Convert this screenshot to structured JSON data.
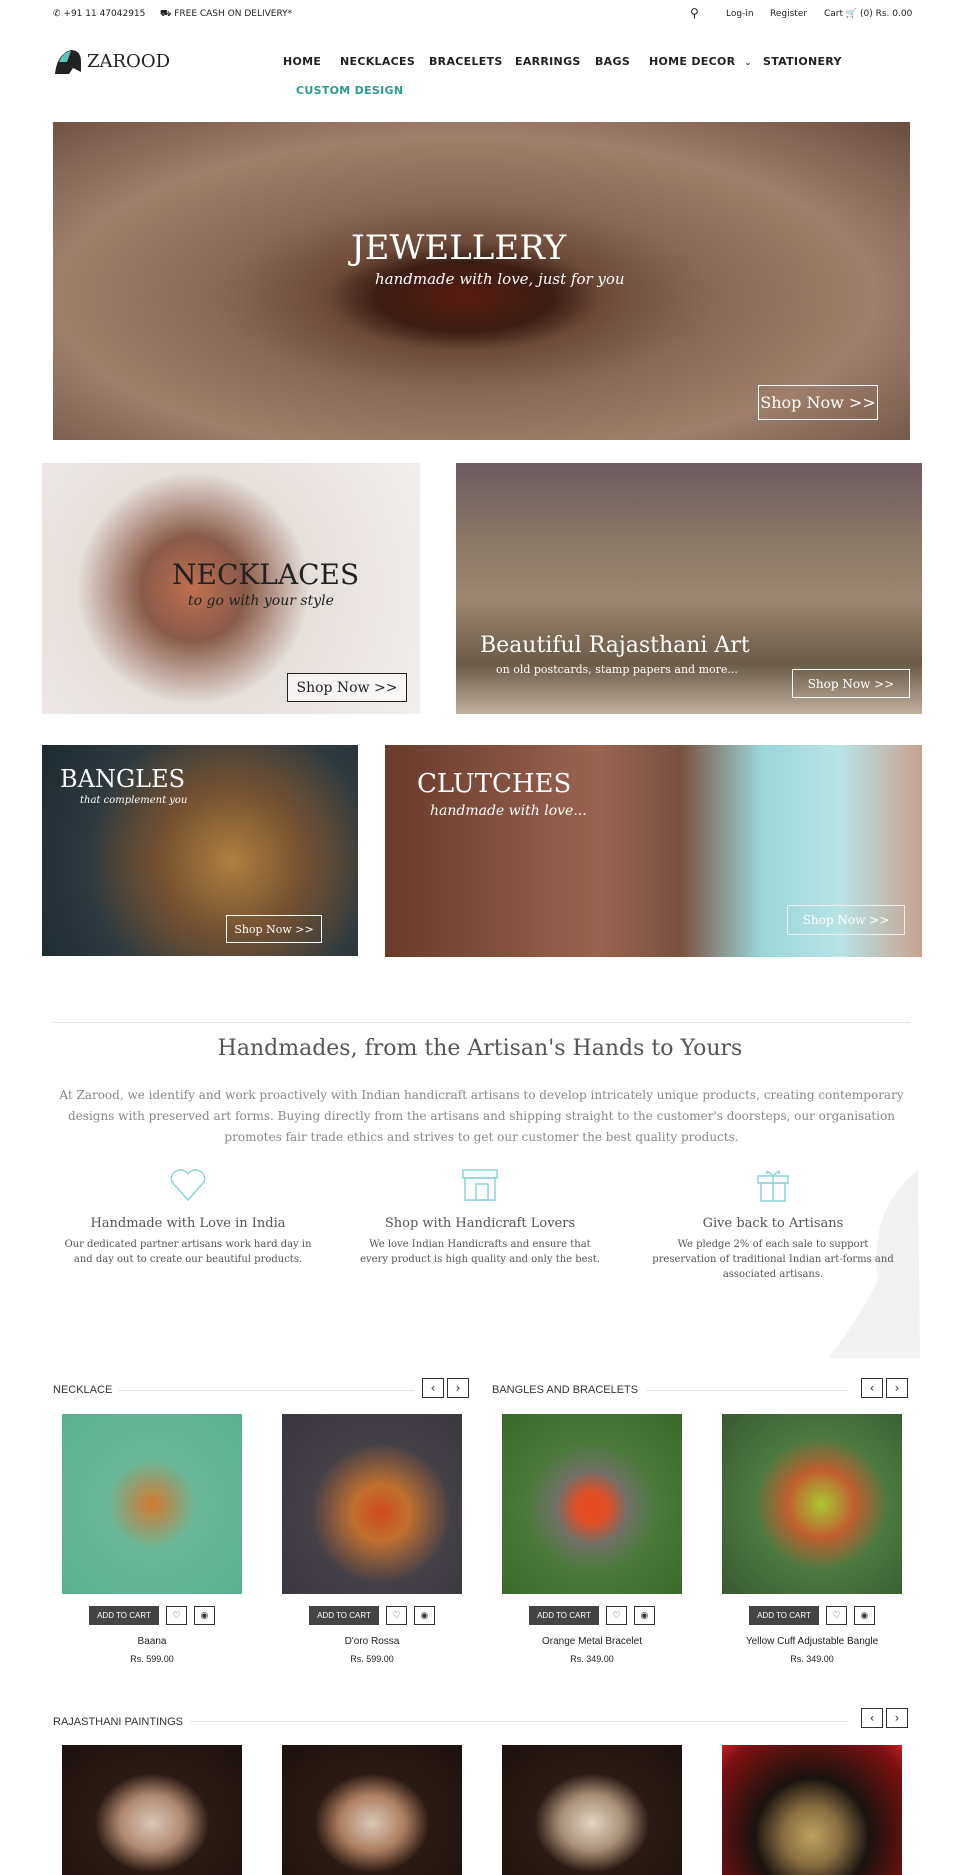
{
  "topbar": {
    "phone": "+91 11 47042915",
    "delivery": "FREE CASH ON DELIVERY*",
    "login": "Log-in",
    "register": "Register",
    "cart_label": "Cart",
    "cart_info": "(0) Rs. 0.00"
  },
  "logo": {
    "text": "ZAROOD"
  },
  "nav": {
    "items": [
      "HOME",
      "NECKLACES",
      "BRACELETS",
      "EARRINGS",
      "BAGS",
      "HOME DECOR",
      "STATIONERY"
    ],
    "custom": "CUSTOM DESIGN"
  },
  "hero": {
    "title": "JEWELLERY",
    "subtitle": "handmade with love, just for you",
    "button": "Shop Now >>"
  },
  "banners": {
    "necklaces": {
      "title": "NECKLACES",
      "subtitle": "to go with your style",
      "button": "Shop Now >>"
    },
    "rajasthani": {
      "title": "Beautiful Rajasthani Art",
      "subtitle": "on old postcards, stamp papers and more...",
      "button": "Shop Now >>"
    },
    "bangles": {
      "title": "BANGLES",
      "subtitle": "that complement you",
      "button": "Shop Now >>"
    },
    "clutches": {
      "title": "CLUTCHES",
      "subtitle": "handmade with love...",
      "button": "Shop Now >>"
    }
  },
  "about": {
    "heading": "Handmades, from the Artisan's Hands to Yours",
    "text": "At Zarood, we identify and work proactively with Indian handicraft artisans to develop intricately unique products, creating contemporary designs with preserved art forms. Buying directly from the artisans and shipping straight to the customer's doorsteps, our organisation promotes fair trade ethics and strives to get our customer the best quality products.",
    "features": [
      {
        "icon": "heart-icon",
        "title": "Handmade with Love in India",
        "desc": "Our dedicated partner artisans work hard day in and day out to create our beautiful products."
      },
      {
        "icon": "shop-icon",
        "title": "Shop with Handicraft Lovers",
        "desc": "We love Indian Handicrafts and ensure that every product is high quality and only the best."
      },
      {
        "icon": "gift-icon",
        "title": "Give back to Artisans",
        "desc": "We pledge 2% of each sale to support preservation of traditional Indian art-forms and associated artisans."
      }
    ]
  },
  "sections": {
    "necklace": "NECKLACE",
    "bangles": "BANGLES AND BRACELETS",
    "paintings": "RAJASTHANI PAINTINGS"
  },
  "products": [
    {
      "name": "Baana",
      "price": "Rs. 599.00"
    },
    {
      "name": "D'oro Rossa",
      "price": "Rs. 599.00"
    },
    {
      "name": "Orange Metal Bracelet",
      "price": "Rs. 349.00"
    },
    {
      "name": "Yellow Cuff Adjustable Bangle",
      "price": "Rs. 349.00"
    }
  ],
  "product_button": "ADD TO CART",
  "accent": "#2a9d8f",
  "icon_color": "#8fd3d6"
}
